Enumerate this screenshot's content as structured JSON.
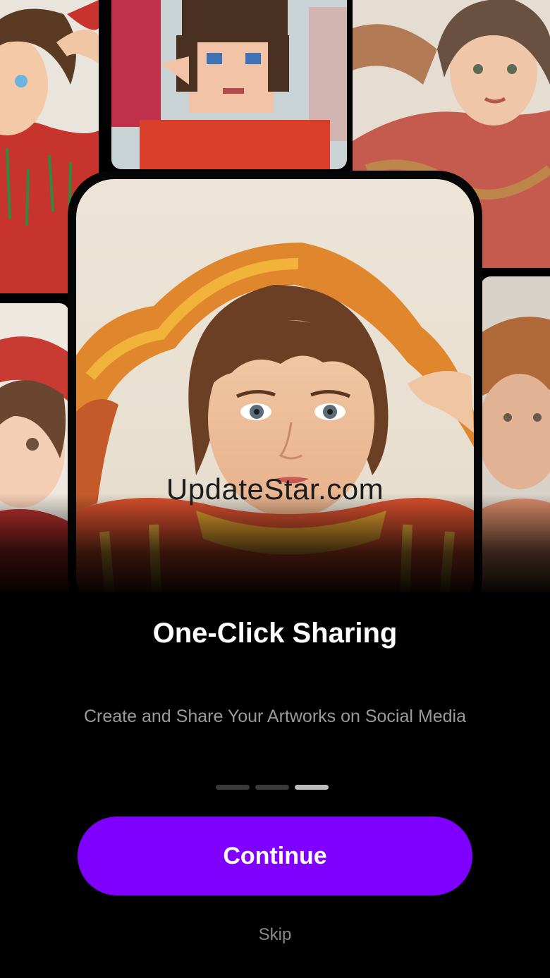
{
  "watermark": "UpdateStar.com",
  "onboarding": {
    "title": "One-Click Sharing",
    "subtitle": "Create and Share Your Artworks on Social Media",
    "page_indicator": {
      "current": 3,
      "total": 3
    },
    "continue_label": "Continue",
    "skip_label": "Skip"
  },
  "colors": {
    "background": "#000000",
    "accent": "#7f00ff",
    "subtitle": "#9a9a9a",
    "indicator_active": "#bdbdbd",
    "indicator_inactive": "#3a3a3a"
  }
}
